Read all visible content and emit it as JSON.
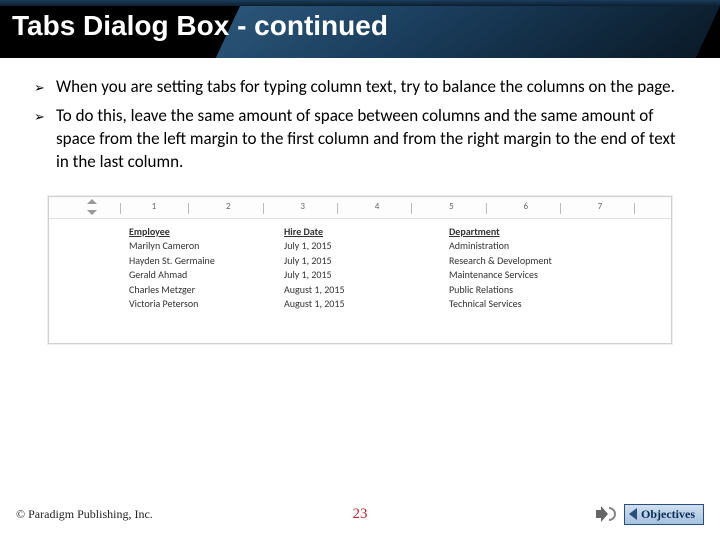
{
  "title": "Tabs Dialog Box - continued",
  "bullets": [
    "When you are setting tabs for typing column text, try to balance the columns on the page.",
    "To do this, leave the same amount of space between columns and the same amount of space from the left margin to the first column and from the right margin to the end of text in the last column."
  ],
  "ruler_numbers": [
    "1",
    "2",
    "3",
    "4",
    "5",
    "6",
    "7"
  ],
  "table": {
    "headers": [
      "Employee",
      "Hire Date",
      "Department"
    ],
    "rows": [
      [
        "Marilyn Cameron",
        "July 1, 2015",
        "Administration"
      ],
      [
        "Hayden St. Germaine",
        "July 1, 2015",
        "Research & Development"
      ],
      [
        "Gerald Ahmad",
        "July 1, 2015",
        "Maintenance Services"
      ],
      [
        "Charles Metzger",
        "August 1, 2015",
        "Public Relations"
      ],
      [
        "Victoria Peterson",
        "August 1, 2015",
        "Technical Services"
      ]
    ]
  },
  "footer": {
    "copyright": "© Paradigm Publishing, Inc.",
    "page": "23",
    "nav_label": "Objectives"
  }
}
